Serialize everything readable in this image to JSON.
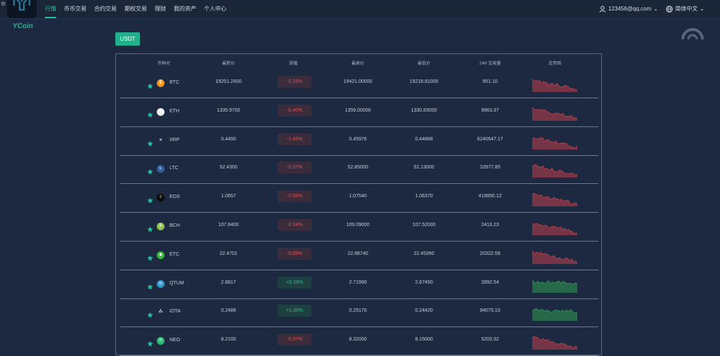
{
  "brand": {
    "name": "YCoin"
  },
  "nav": {
    "items": [
      {
        "label": "行情",
        "active": true
      },
      {
        "label": "币币交易",
        "active": false
      },
      {
        "label": "合约交易",
        "active": false
      },
      {
        "label": "期权交易",
        "active": false
      },
      {
        "label": "理财",
        "active": false
      },
      {
        "label": "我的资产",
        "active": false
      },
      {
        "label": "个人中心",
        "active": false
      }
    ]
  },
  "user": {
    "email": "123456@qq.com",
    "icon": "user-icon",
    "caret": "⌄"
  },
  "language": {
    "label": "简体中文",
    "icon": "globe-icon",
    "caret": "⌄"
  },
  "tabs": {
    "active": "USDT"
  },
  "table": {
    "headers": {
      "pair": "币种对",
      "last": "最新价",
      "change": "涨幅",
      "high": "最高价",
      "low": "最低价",
      "volume": "24H 交易量",
      "trend": "走势图"
    },
    "rows": [
      {
        "coin": "BTC",
        "icon_color": "#f7931a",
        "icon_glyph": "₿",
        "last": "19251.2400",
        "change": "-0.25%",
        "direction": "down",
        "high": "19421.00000",
        "low": "19218.81000",
        "volume": "951.10",
        "trend_color": "#c0404a"
      },
      {
        "coin": "ETH",
        "icon_color": "#ecf0f1",
        "icon_glyph": "◆",
        "last": "1335.9700",
        "change": "-0.40%",
        "direction": "down",
        "high": "1359.00000",
        "low": "1330.83000",
        "volume": "9963.37",
        "trend_color": "#c0404a"
      },
      {
        "coin": "XRP",
        "icon_color": "#1d2940",
        "icon_glyph": "✕",
        "last": "0.4490",
        "change": "-1.46%",
        "direction": "down",
        "high": "0.45976",
        "low": "0.44888",
        "volume": "6240647.17",
        "trend_color": "#c0404a"
      },
      {
        "coin": "LTC",
        "icon_color": "#345d9d",
        "icon_glyph": "Ł",
        "last": "52.4300",
        "change": "-0.27%",
        "direction": "down",
        "high": "52.85000",
        "low": "52.13000",
        "volume": "10977.85",
        "trend_color": "#c0404a"
      },
      {
        "coin": "EOS",
        "icon_color": "#0b0b0b",
        "icon_glyph": "◊",
        "last": "1.0657",
        "change": "-0.58%",
        "direction": "down",
        "high": "1.07540",
        "low": "1.06370",
        "volume": "419850.12",
        "trend_color": "#c0404a"
      },
      {
        "coin": "BCH",
        "icon_color": "#8dc351",
        "icon_glyph": "B",
        "last": "107.8400",
        "change": "-0.24%",
        "direction": "down",
        "high": "109.09000",
        "low": "107.52000",
        "volume": "2413.23",
        "trend_color": "#c0404a"
      },
      {
        "coin": "ETC",
        "icon_color": "#3ab83a",
        "icon_glyph": "◆",
        "last": "22.4701",
        "change": "-0.69%",
        "direction": "down",
        "high": "22.88740",
        "low": "22.45390",
        "volume": "20322.58",
        "trend_color": "#c0404a"
      },
      {
        "coin": "QTUM",
        "icon_color": "#2e9ad0",
        "icon_glyph": "◎",
        "last": "2.6817",
        "change": "+0.19%",
        "direction": "up",
        "high": "2.71990",
        "low": "2.67490",
        "volume": "2892.54",
        "trend_color": "#2f9a52"
      },
      {
        "coin": "IOTA",
        "icon_color": "#1d2940",
        "icon_glyph": "⁂",
        "last": "0.2486",
        "change": "+1.30%",
        "direction": "up",
        "high": "0.25170",
        "low": "0.24420",
        "volume": "94075.10",
        "trend_color": "#2f9a52"
      },
      {
        "coin": "NEO",
        "icon_color": "#2ab874",
        "icon_glyph": "N",
        "last": "8.2100",
        "change": "-0.97%",
        "direction": "down",
        "high": "8.32000",
        "low": "8.15000",
        "volume": "5203.32",
        "trend_color": "#c0404a"
      }
    ]
  },
  "colors": {
    "accent": "#22c197",
    "down": "#e84e56",
    "up": "#22c197",
    "background": "#1d2940"
  }
}
